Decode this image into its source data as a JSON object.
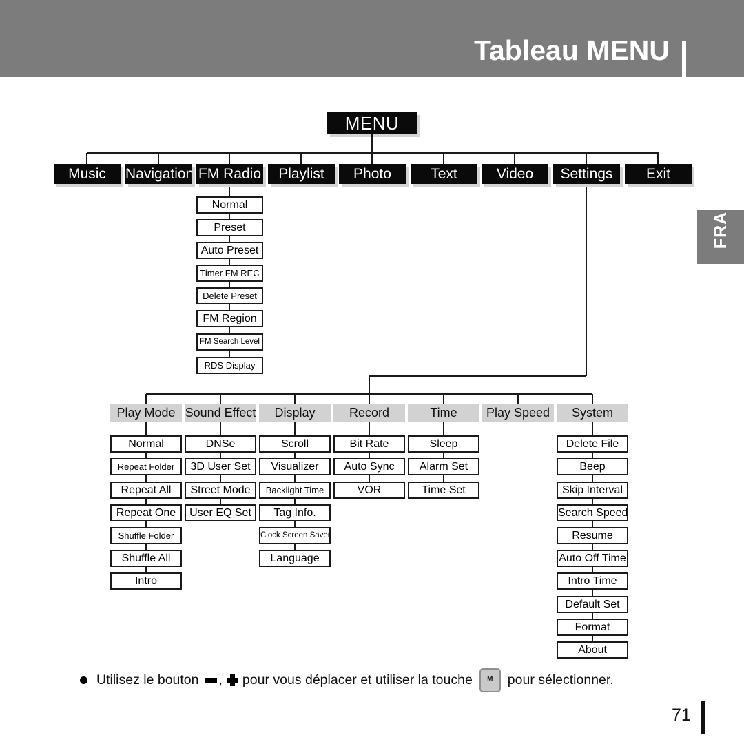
{
  "header": {
    "title": "Tableau MENU"
  },
  "language_tab": {
    "label": "FRA"
  },
  "chart_data": {
    "type": "tree",
    "title": "Tableau MENU",
    "root": "MENU",
    "level1": [
      "Music",
      "Navigation",
      "FM Radio",
      "Playlist",
      "Photo",
      "Text",
      "Video",
      "Settings",
      "Exit"
    ],
    "fm_radio_children": [
      "Normal",
      "Preset",
      "Auto Preset",
      "Timer FM REC",
      "Delete Preset",
      "FM Region",
      "FM Search Level",
      "RDS Display"
    ],
    "settings_groups": [
      {
        "name": "Play Mode",
        "items": [
          "Normal",
          "Repeat Folder",
          "Repeat All",
          "Repeat One",
          "Shuffle Folder",
          "Shuffle All",
          "Intro"
        ]
      },
      {
        "name": "Sound Effect",
        "items": [
          "DNSe",
          "3D User Set",
          "Street Mode",
          "User EQ Set"
        ]
      },
      {
        "name": "Display",
        "items": [
          "Scroll",
          "Visualizer",
          "Backlight Time",
          "Tag Info.",
          "Clock Screen Saver",
          "Language"
        ]
      },
      {
        "name": "Record",
        "items": [
          "Bit Rate",
          "Auto Sync",
          "VOR"
        ]
      },
      {
        "name": "Time",
        "items": [
          "Sleep",
          "Alarm Set",
          "Time Set"
        ]
      },
      {
        "name": "Play Speed",
        "items": []
      },
      {
        "name": "System",
        "items": [
          "Delete File",
          "Beep",
          "Skip Interval",
          "Search Speed",
          "Resume",
          "Auto Off Time",
          "Intro Time",
          "Default Set",
          "Format",
          "About"
        ]
      }
    ]
  },
  "nodes": {
    "root": "MENU",
    "music": "Music",
    "navigation": "Navigation",
    "fm_radio": "FM Radio",
    "playlist": "Playlist",
    "photo": "Photo",
    "text": "Text",
    "video": "Video",
    "settings": "Settings",
    "exit": "Exit",
    "fm_normal": "Normal",
    "fm_preset": "Preset",
    "fm_auto_preset": "Auto Preset",
    "fm_timer_rec": "Timer FM REC",
    "fm_delete_preset": "Delete Preset",
    "fm_region": "FM Region",
    "fm_search_level": "FM Search Level",
    "fm_rds_display": "RDS Display",
    "g_play_mode": "Play Mode",
    "g_sound_effect": "Sound Effect",
    "g_display": "Display",
    "g_record": "Record",
    "g_time": "Time",
    "g_play_speed": "Play Speed",
    "g_system": "System",
    "pm_normal": "Normal",
    "pm_repeat_folder": "Repeat Folder",
    "pm_repeat_all": "Repeat All",
    "pm_repeat_one": "Repeat One",
    "pm_shuffle_folder": "Shuffle Folder",
    "pm_shuffle_all": "Shuffle All",
    "pm_intro": "Intro",
    "se_dnse": "DNSe",
    "se_3d_user_set": "3D User Set",
    "se_street_mode": "Street Mode",
    "se_user_eq_set": "User EQ Set",
    "dp_scroll": "Scroll",
    "dp_visualizer": "Visualizer",
    "dp_backlight_time": "Backlight Time",
    "dp_tag_info": "Tag Info.",
    "dp_clock_screen_saver": "Clock Screen Saver",
    "dp_language": "Language",
    "rc_bit_rate": "Bit Rate",
    "rc_auto_sync": "Auto Sync",
    "rc_vor": "VOR",
    "tm_sleep": "Sleep",
    "tm_alarm_set": "Alarm Set",
    "tm_time_set": "Time Set",
    "sy_delete_file": "Delete File",
    "sy_beep": "Beep",
    "sy_skip_interval": "Skip Interval",
    "sy_search_speed": "Search Speed",
    "sy_resume": "Resume",
    "sy_auto_off_time": "Auto Off Time",
    "sy_intro_time": "Intro Time",
    "sy_default_set": "Default Set",
    "sy_format": "Format",
    "sy_about": "About"
  },
  "footer": {
    "text_before": "Utilisez le bouton",
    "comma": ",",
    "text_middle": "pour vous déplacer et utiliser la touche",
    "key_label": "M",
    "text_after": "pour sélectionner."
  },
  "page": {
    "number": "71"
  },
  "colors": {
    "header_gray": "#7c7c7c",
    "node_black": "#0a0a0a",
    "group_gray": "#d2d2d2",
    "line": "#1a1a1a"
  }
}
